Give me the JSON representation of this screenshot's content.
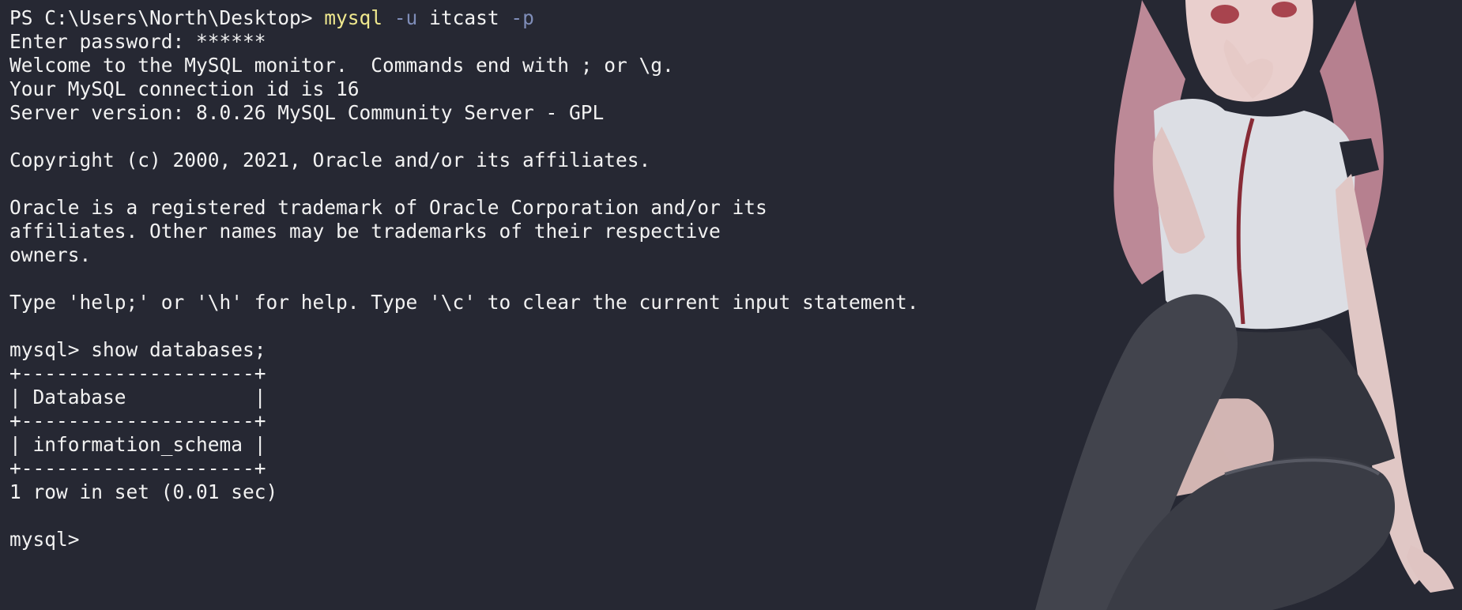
{
  "colors": {
    "background": "#262833",
    "foreground": "#f2f2f2",
    "command": "#f0e98e",
    "flag": "#7f8db8"
  },
  "first_command": {
    "prompt": "PS C:\\Users\\North\\Desktop> ",
    "program": "mysql",
    "flag_user": "-u",
    "user": "itcast",
    "flag_password": "-p"
  },
  "lines": [
    "Enter password: ******",
    "Welcome to the MySQL monitor.  Commands end with ; or \\g.",
    "Your MySQL connection id is 16",
    "Server version: 8.0.26 MySQL Community Server - GPL",
    "",
    "Copyright (c) 2000, 2021, Oracle and/or its affiliates.",
    "",
    "Oracle is a registered trademark of Oracle Corporation and/or its",
    "affiliates. Other names may be trademarks of their respective",
    "owners.",
    "",
    "Type 'help;' or '\\h' for help. Type '\\c' to clear the current input statement.",
    "",
    "mysql> show databases;",
    "+--------------------+",
    "| Database           |",
    "+--------------------+",
    "| information_schema |",
    "+--------------------+",
    "1 row in set (0.01 sec)",
    ""
  ],
  "current_prompt": "mysql> "
}
